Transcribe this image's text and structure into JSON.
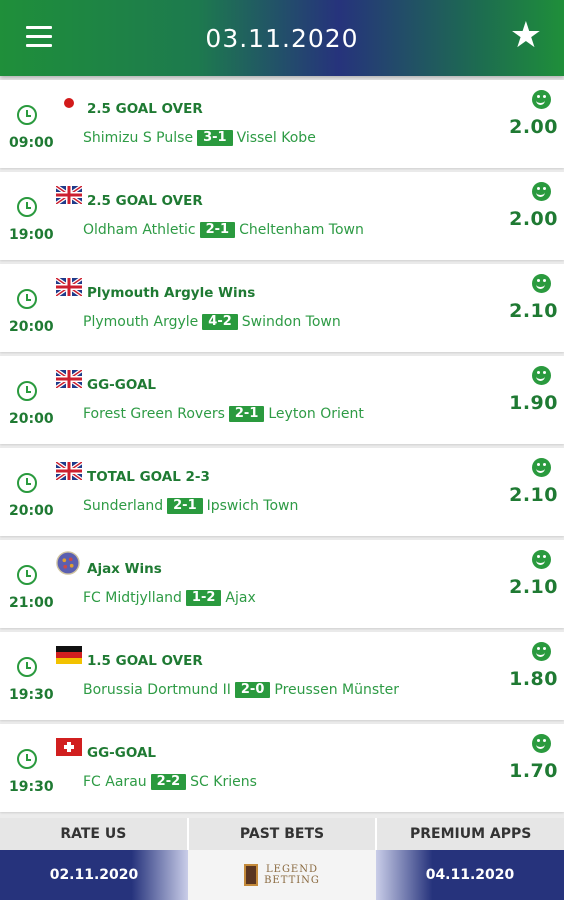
{
  "header": {
    "date": "03.11.2020",
    "menu_icon": "hamburger-menu-icon",
    "favorite_icon": "star-icon"
  },
  "colors": {
    "accent_green": "#2a9a3e",
    "header_blue": "#26337c"
  },
  "predictions": [
    {
      "time": "09:00",
      "flag": "japan",
      "tip": "2.5 GOAL OVER",
      "home": "Shimizu S Pulse",
      "score": "3-1",
      "away": "Vissel Kobe",
      "odds": "2.00",
      "status_icon": "smile-icon"
    },
    {
      "time": "19:00",
      "flag": "uk",
      "tip": "2.5 GOAL OVER",
      "home": "Oldham Athletic",
      "score": "2-1",
      "away": "Cheltenham Town",
      "odds": "2.00",
      "status_icon": "smile-icon"
    },
    {
      "time": "20:00",
      "flag": "uk",
      "tip": "Plymouth Argyle Wins",
      "home": "Plymouth Argyle",
      "score": "4-2",
      "away": "Swindon Town",
      "odds": "2.10",
      "status_icon": "smile-icon"
    },
    {
      "time": "20:00",
      "flag": "uk",
      "tip": "GG-GOAL",
      "home": "Forest Green Rovers",
      "score": "2-1",
      "away": "Leyton Orient",
      "odds": "1.90",
      "status_icon": "smile-icon"
    },
    {
      "time": "20:00",
      "flag": "uk",
      "tip": "TOTAL GOAL 2-3",
      "home": "Sunderland",
      "score": "2-1",
      "away": "Ipswich Town",
      "odds": "2.10",
      "status_icon": "smile-icon"
    },
    {
      "time": "21:00",
      "flag": "europe",
      "tip": "Ajax Wins",
      "home": "FC Midtjylland",
      "score": "1-2",
      "away": "Ajax",
      "odds": "2.10",
      "status_icon": "smile-icon"
    },
    {
      "time": "19:30",
      "flag": "germany",
      "tip": "1.5 GOAL OVER",
      "home": "Borussia Dortmund II",
      "score": "2-0",
      "away": "Preussen Münster",
      "odds": "1.80",
      "status_icon": "smile-icon"
    },
    {
      "time": "19:30",
      "flag": "switzerland",
      "tip": "GG-GOAL",
      "home": "FC Aarau",
      "score": "2-2",
      "away": "SC Kriens",
      "odds": "1.70",
      "status_icon": "smile-icon"
    }
  ],
  "tabs": {
    "rate": "RATE US",
    "past": "PAST BETS",
    "premium": "PREMIUM APPS"
  },
  "footer": {
    "prev_date": "02.11.2020",
    "next_date": "04.11.2020",
    "logo_line1": "LEGEND",
    "logo_line2": "BETTING"
  }
}
